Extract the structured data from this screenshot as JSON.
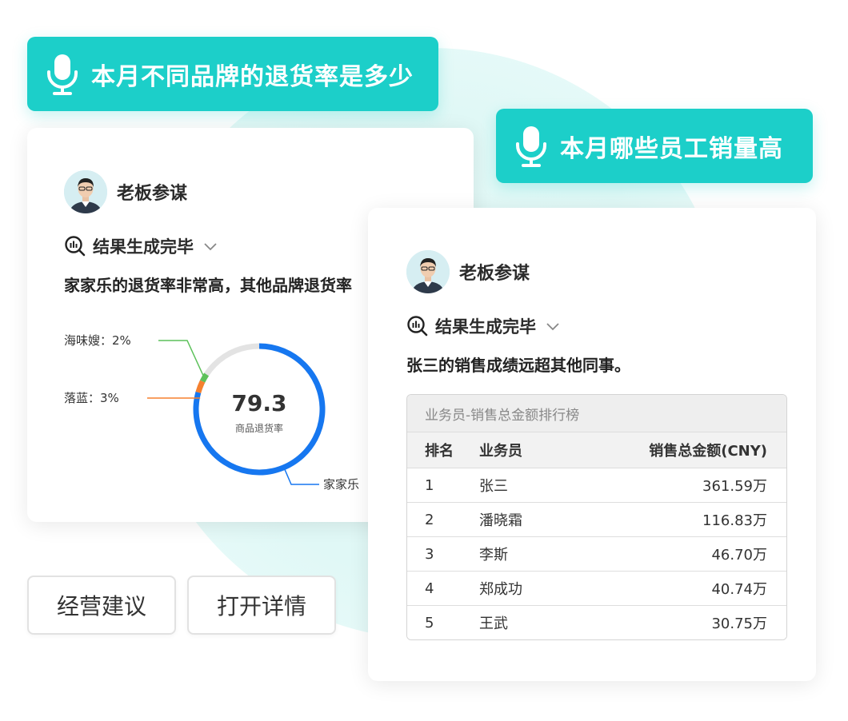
{
  "voice_queries": {
    "q1": "本月不同品牌的退货率是多少",
    "q2": "本月哪些员工销量高"
  },
  "card_left": {
    "agent_name": "老板参谋",
    "status": "结果生成完毕",
    "summary": "家家乐的退货率非常高，其他品牌退货率",
    "chart_data": {
      "type": "pie",
      "center_value": "79.3",
      "center_label": "商品退货率",
      "slices": [
        {
          "name": "海味嫂",
          "label": "海味嫂：2%",
          "value": 2,
          "color": "#5cc15a"
        },
        {
          "name": "落蓝",
          "label": "落蓝：3%",
          "value": 3,
          "color": "#f5802f"
        },
        {
          "name": "家家乐",
          "label": "家家乐",
          "value": 79.3,
          "color": "#1677f0"
        }
      ],
      "remainder_color": "#e3e3e3"
    }
  },
  "buttons": {
    "advice": "经营建议",
    "details": "打开详情"
  },
  "card_right": {
    "agent_name": "老板参谋",
    "status": "结果生成完毕",
    "summary": "张三的销售成绩远超其他同事。",
    "table": {
      "caption": "业务员-销售总金额排行榜",
      "headers": [
        "排名",
        "业务员",
        "销售总金额(CNY)"
      ],
      "rows": [
        [
          "1",
          "张三",
          "361.59万"
        ],
        [
          "2",
          "潘晓霜",
          "116.83万"
        ],
        [
          "3",
          "李斯",
          "46.70万"
        ],
        [
          "4",
          "郑成功",
          "40.74万"
        ],
        [
          "5",
          "王武",
          "30.75万"
        ]
      ]
    }
  },
  "icons": {
    "mic": "microphone-icon",
    "search": "search-analysis-icon",
    "chevron": "chevron-down-icon"
  },
  "colors": {
    "accent": "#1ccfc9",
    "line_blue": "#1677f0",
    "green": "#5cc15a",
    "orange": "#f5802f"
  }
}
